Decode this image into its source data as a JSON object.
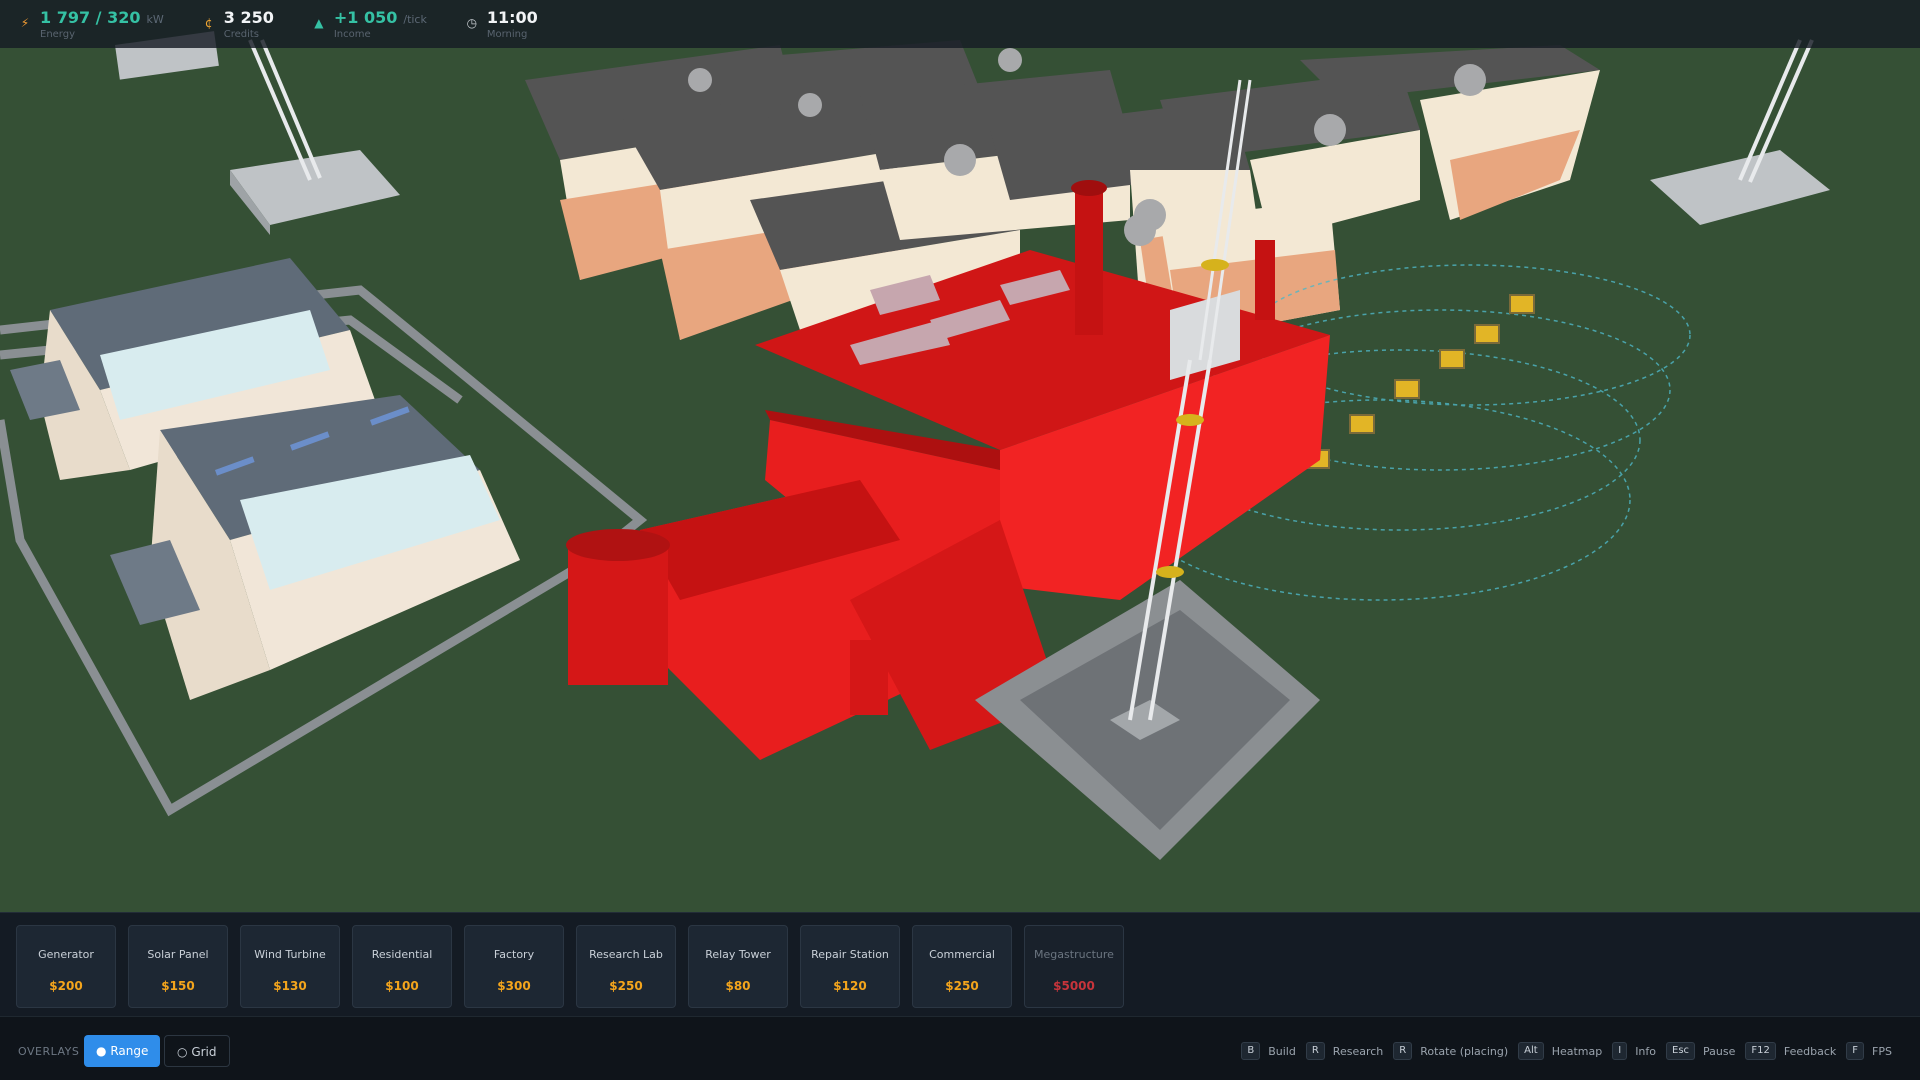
{
  "hud": {
    "energy": {
      "value": "1 797 / 320",
      "unit": "kW",
      "label": "Energy"
    },
    "credits": {
      "value": "3 250",
      "label": "Credits"
    },
    "income": {
      "value": "+1 050",
      "unit": "/tick",
      "label": "Income"
    },
    "time": {
      "value": "11:00",
      "label": "Morning"
    }
  },
  "build_cards": [
    {
      "name": "Generator",
      "price": "$200"
    },
    {
      "name": "Solar Panel",
      "price": "$150"
    },
    {
      "name": "Wind Turbine",
      "price": "$130"
    },
    {
      "name": "Residential",
      "price": "$100"
    },
    {
      "name": "Factory",
      "price": "$300"
    },
    {
      "name": "Research Lab",
      "price": "$250"
    },
    {
      "name": "Relay Tower",
      "price": "$80"
    },
    {
      "name": "Repair Station",
      "price": "$120"
    },
    {
      "name": "Commercial",
      "price": "$250"
    },
    {
      "name": "Megastructure",
      "price": "$5000"
    }
  ],
  "overlays": {
    "label": "OVERLAYS",
    "range": "Range",
    "grid": "Grid"
  },
  "shortcuts": [
    {
      "key": "B",
      "label": "Build"
    },
    {
      "key": "R",
      "label": "Research"
    },
    {
      "key": "R",
      "label": "Rotate (placing)"
    },
    {
      "key": "Alt",
      "label": "Heatmap"
    },
    {
      "key": "I",
      "label": "Info"
    },
    {
      "key": "Esc",
      "label": "Pause"
    },
    {
      "key": "F12",
      "label": "Feedback"
    },
    {
      "key": "F",
      "label": "FPS"
    }
  ],
  "colors": {
    "ground": "#355035",
    "factory": "#e81e1e",
    "accent": "#2f8dea",
    "price": "#f4a51c",
    "locked_price": "#c7343b",
    "energy": "#35c1a4"
  }
}
